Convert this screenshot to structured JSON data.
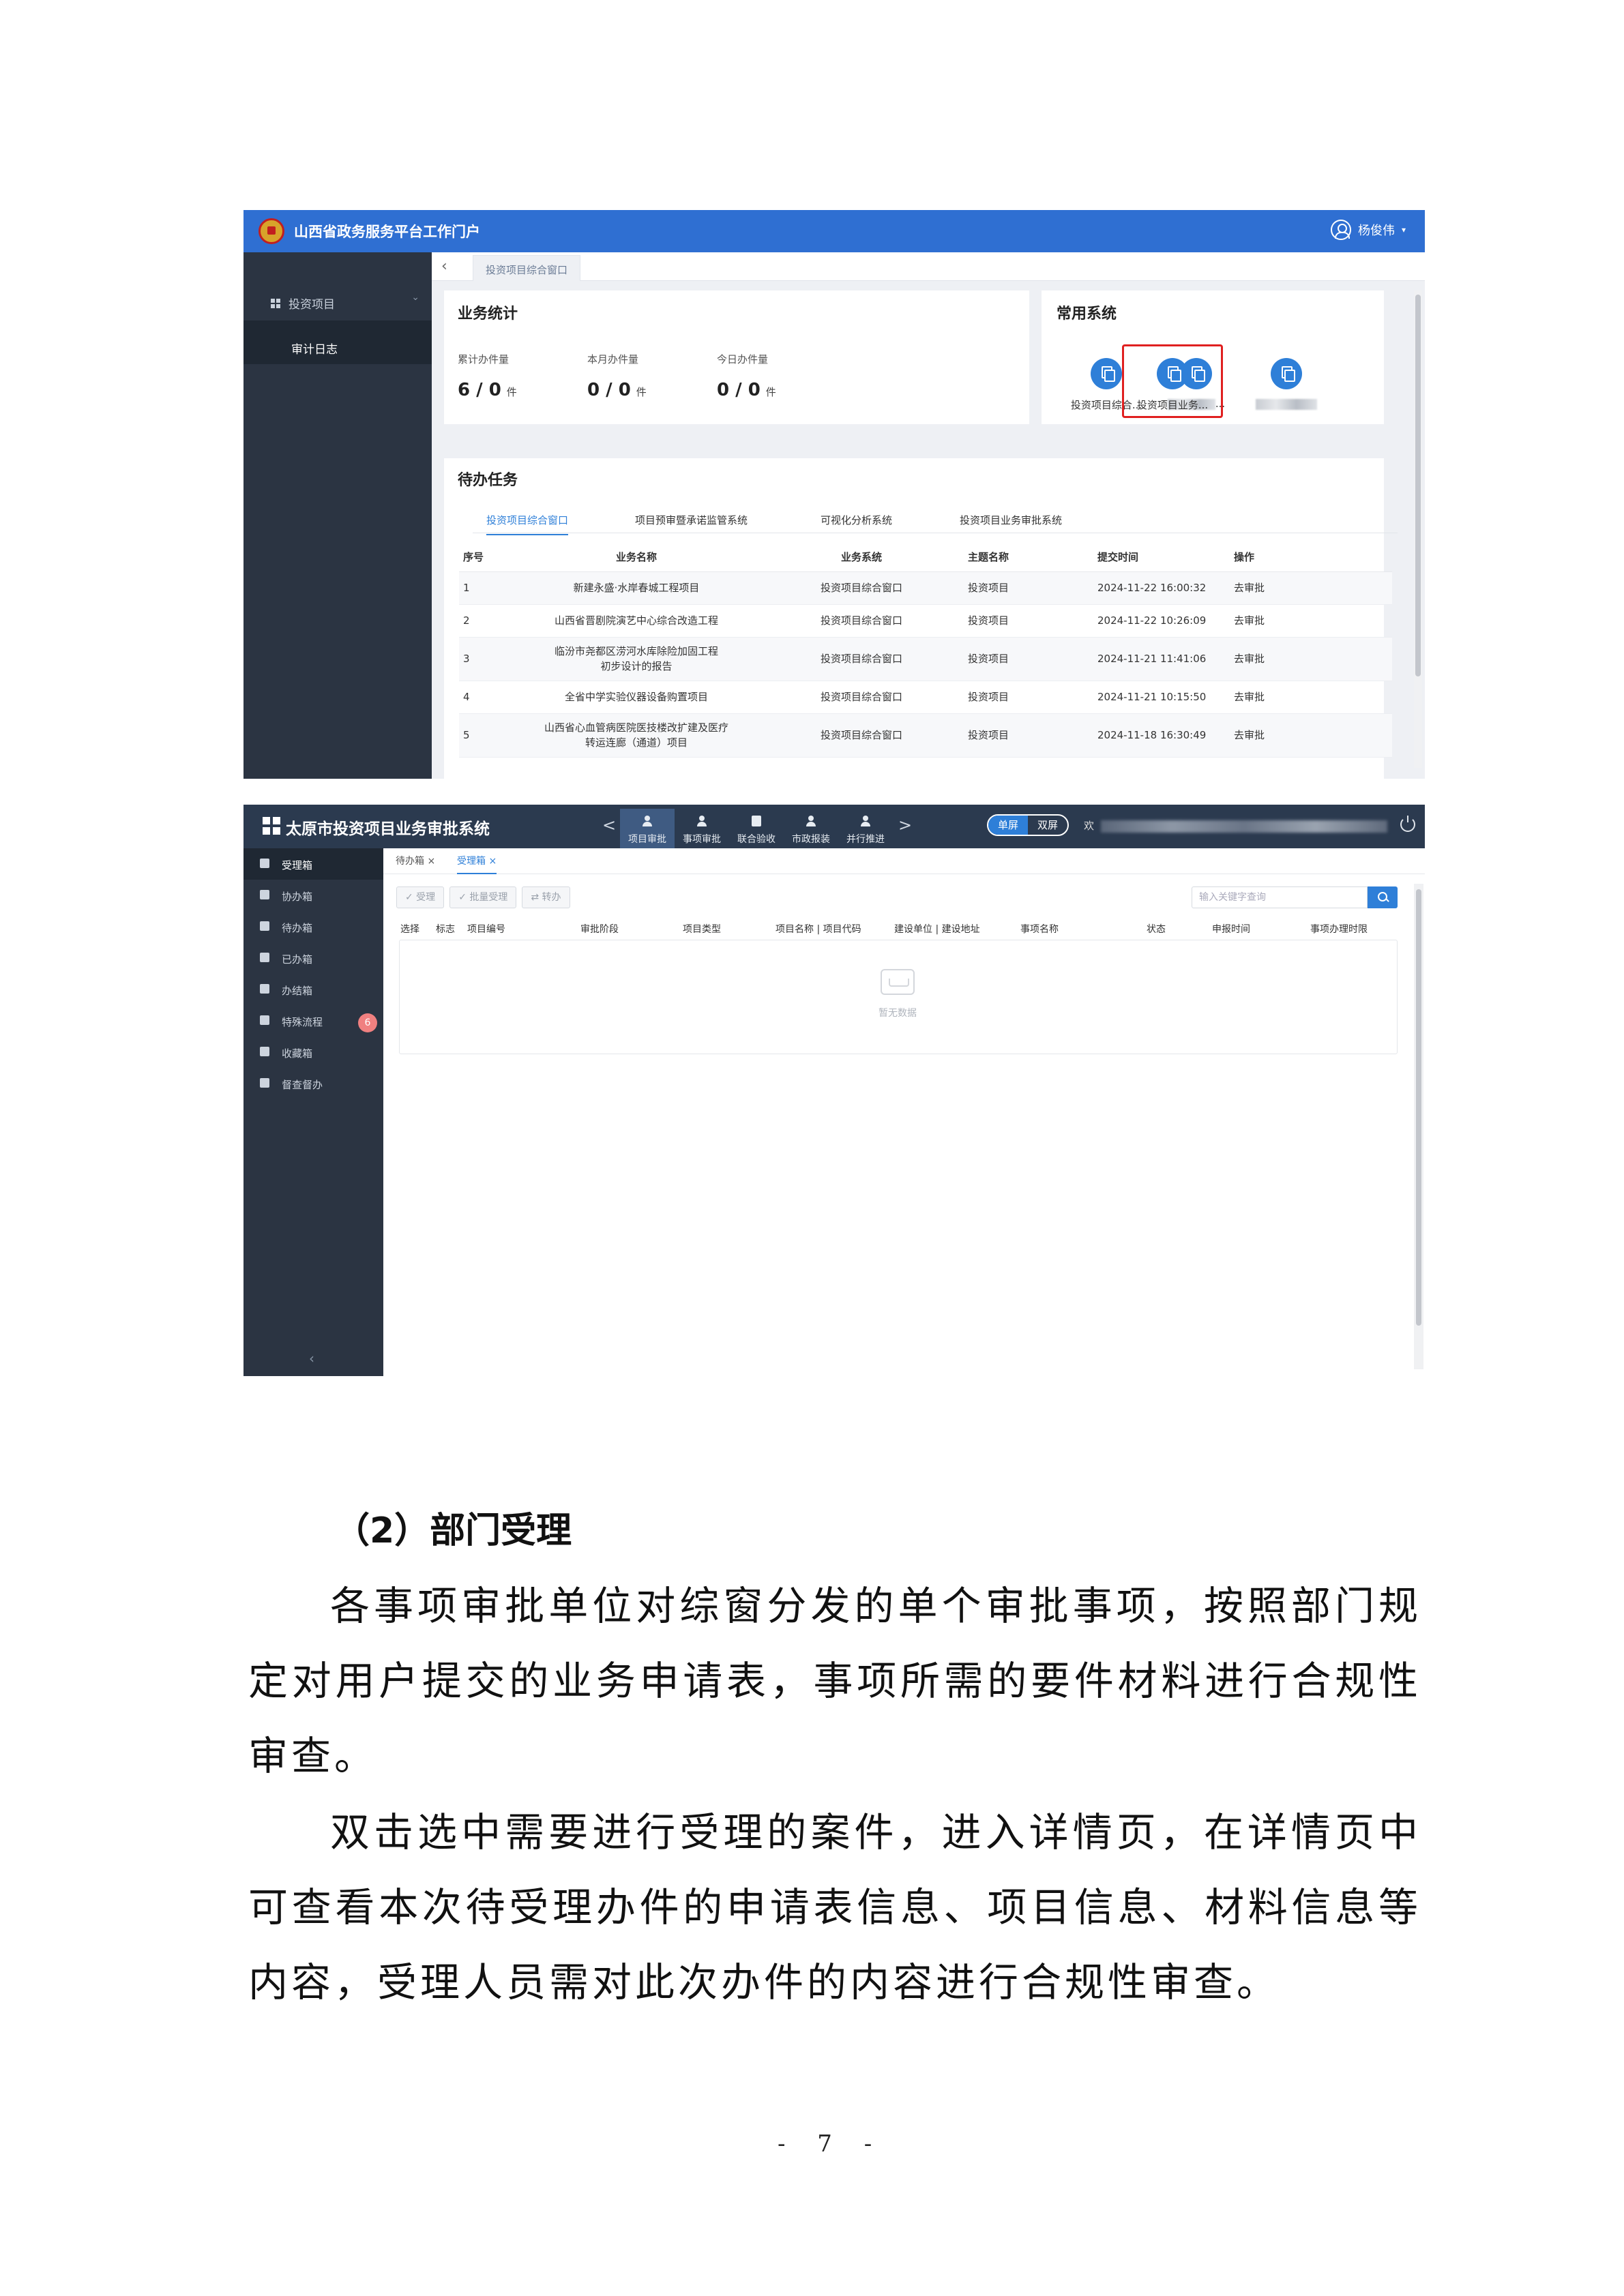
{
  "screenshot1": {
    "portal_title": "山西省政务服务平台工作门户",
    "user_name": "杨俊伟",
    "user_caret": "▾",
    "sidebar_group": "投资项目",
    "sidebar_item": "审计日志",
    "sidebar_chevron": "⌄",
    "back_arrow": "‹",
    "active_tab": "投资项目综合窗口",
    "stats_title": "业务统计",
    "stats": [
      {
        "label": "累计办件量",
        "value": "6 / 0",
        "unit": "件"
      },
      {
        "label": "本月办件量",
        "value": "0 / 0",
        "unit": "件"
      },
      {
        "label": "今日办件量",
        "value": "0 / 0",
        "unit": "件"
      }
    ],
    "systems_title": "常用系统",
    "systems": [
      {
        "label": "投资项目综合..."
      },
      {
        "label_suffix": "..."
      },
      {
        "label_suffix": ""
      },
      {
        "label": "投资项目业务..."
      }
    ],
    "todo_title": "待办任务",
    "todo_tabs": [
      "投资项目综合窗口",
      "项目预审暨承诺监管系统",
      "可视化分析系统",
      "投资项目业务审批系统"
    ],
    "table_headers": [
      "序号",
      "业务名称",
      "业务系统",
      "主题名称",
      "提交时间",
      "操作"
    ],
    "rows": [
      {
        "no": "1",
        "name": "新建永盛·水岸春城工程项目",
        "system": "投资项目综合窗口",
        "theme": "投资项目",
        "time": "2024-11-22 16:00:32",
        "action": "去审批"
      },
      {
        "no": "2",
        "name": "山西省晋剧院演艺中心综合改造工程",
        "system": "投资项目综合窗口",
        "theme": "投资项目",
        "time": "2024-11-22 10:26:09",
        "action": "去审批"
      },
      {
        "no": "3",
        "name": "临汾市尧都区涝河水库除险加固工程初步设计的报告",
        "system": "投资项目综合窗口",
        "theme": "投资项目",
        "time": "2024-11-21 11:41:06",
        "action": "去审批"
      },
      {
        "no": "4",
        "name": "全省中学实验仪器设备购置项目",
        "system": "投资项目综合窗口",
        "theme": "投资项目",
        "time": "2024-11-21 10:15:50",
        "action": "去审批"
      },
      {
        "no": "5",
        "name": "山西省心血管病医院医技楼改扩建及医疗转运连廊（通道）项目",
        "system": "投资项目综合窗口",
        "theme": "投资项目",
        "time": "2024-11-18 16:30:49",
        "action": "去审批"
      }
    ]
  },
  "screenshot2": {
    "system_title": "太原市投资项目业务审批系统",
    "nav_prev": "<",
    "nav_next": ">",
    "nav_items": [
      "项目审批",
      "事项审批",
      "联合验收",
      "市政报装",
      "并行推进"
    ],
    "screen_toggle": [
      "单屏",
      "双屏"
    ],
    "user_prefix": "欢",
    "sidebar": [
      "受理箱",
      "协办箱",
      "待办箱",
      "已办箱",
      "办结箱",
      "特殊流程",
      "收藏箱",
      "督查督办"
    ],
    "special_badge": "6",
    "collapse_arrow": "‹",
    "tabs": [
      "待办箱 ×",
      "受理箱 ×"
    ],
    "toolbar": [
      "✓ 受理",
      "✓ 批量受理",
      "⇄ 转办"
    ],
    "search_placeholder": "输入关键字查询",
    "table_headers": [
      "选择",
      "标志",
      "项目编号",
      "审批阶段",
      "项目类型",
      "项目名称 | 项目代码",
      "建设单位 | 建设地址",
      "事项名称",
      "状态",
      "申报时间",
      "事项办理时限"
    ],
    "empty_text": "暂无数据"
  },
  "document": {
    "heading": "（2）部门受理",
    "paragraph1": "各事项审批单位对综窗分发的单个审批事项，按照部门规定对用户提交的业务申请表，事项所需的要件材料进行合规性审查。",
    "paragraph2": "双击选中需要进行受理的案件，进入详情页，在详情页中可查看本次待受理办件的申请表信息、项目信息、材料信息等内容，受理人员需对此次办件的内容进行合规性审查。",
    "page_number": "- 7 -"
  }
}
